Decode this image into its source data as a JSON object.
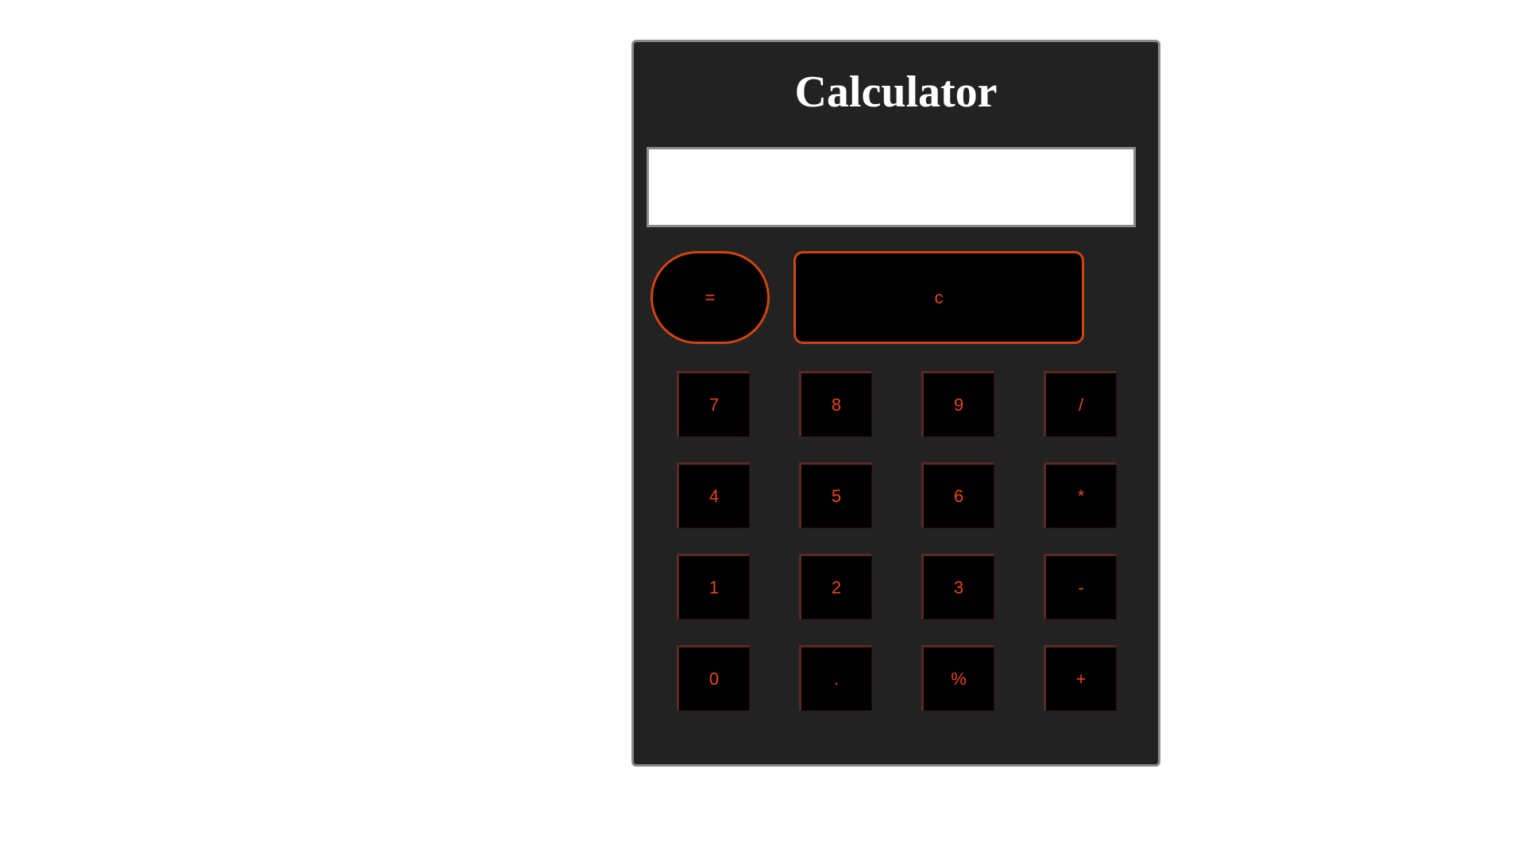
{
  "title": "Calculator",
  "display": {
    "value": ""
  },
  "top_keys": {
    "equals": "=",
    "clear": "c"
  },
  "pad": [
    [
      "7",
      "8",
      "9",
      "/"
    ],
    [
      "4",
      "5",
      "6",
      "*"
    ],
    [
      "1",
      "2",
      "3",
      "-"
    ],
    [
      "0",
      ".",
      "%",
      "+"
    ]
  ],
  "colors": {
    "body_bg": "#222222",
    "key_bg": "#000000",
    "key_text": "#e8441f",
    "top_key_border": "#d2440f",
    "display_bg": "#ffffff",
    "frame_border": "#8a8a8a"
  }
}
